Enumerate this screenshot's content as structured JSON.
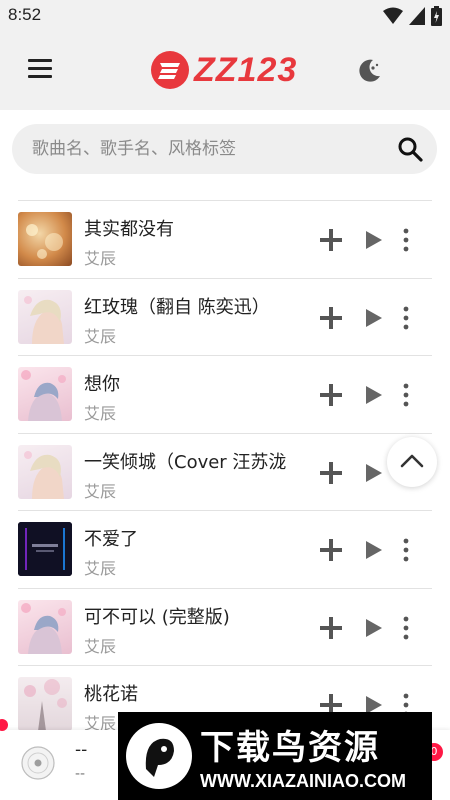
{
  "status_bar": {
    "time": "8:52"
  },
  "header": {
    "logo_text": "ZZ123",
    "brand_color": "#e8383d",
    "menu_icon": "menu-icon",
    "theme_icon": "moon-icon"
  },
  "search": {
    "placeholder": "歌曲名、歌手名、风格标签",
    "value": ""
  },
  "songs": [
    {
      "title": "其实都没有",
      "artist": "艾辰"
    },
    {
      "title": "红玫瑰（翻自 陈奕迅）",
      "artist": "艾辰"
    },
    {
      "title": "想你",
      "artist": "艾辰"
    },
    {
      "title": "一笑倾城（Cover 汪苏泷",
      "artist": "艾辰"
    },
    {
      "title": "不爱了",
      "artist": "艾辰"
    },
    {
      "title": "可不可以 (完整版)",
      "artist": "艾辰"
    },
    {
      "title": "桃花诺",
      "artist": "艾辰"
    }
  ],
  "player": {
    "title": "--",
    "artist": "--",
    "badge": "0"
  },
  "watermark": {
    "title": "下载鸟资源",
    "url": "WWW.XIAZAINIAO.COM"
  }
}
